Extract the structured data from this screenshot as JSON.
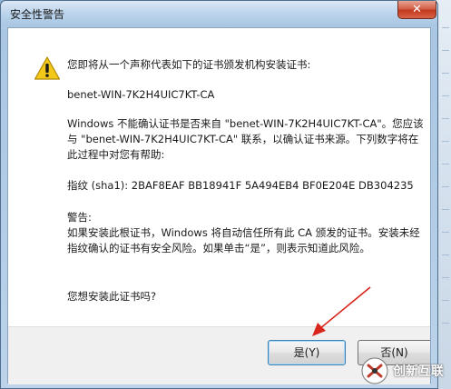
{
  "window": {
    "title": "安全性警告",
    "close_label": "✕"
  },
  "dialog": {
    "intro": "您即将从一个声称代表如下的证书颁发机构安装证书:",
    "ca_name": "benet-WIN-7K2H4UIC7KT-CA",
    "warning_text": "Windows 不能确认证书是否来自 \"benet-WIN-7K2H4UIC7KT-CA\"。您应该与 \"benet-WIN-7K2H4UIC7KT-CA\" 联系，以确认证书来源。下列数字将在此过程中对您有帮助:",
    "thumbprint": "指纹 (sha1): 2BAF8EAF BB18941F 5A494EB4 BF0E204E DB304235",
    "caution_title": "警告:",
    "caution_text": "如果安装此根证书，Windows 将自动信任所有此 CA 颁发的证书。安装未经指纹确认的证书有安全风险。如果单击“是”，则表示知道此风险。",
    "question": "您想安装此证书吗?"
  },
  "buttons": {
    "yes": "是(Y)",
    "no": "否(N)"
  },
  "watermark": {
    "text": "创新互联"
  },
  "colors": {
    "arrow": "#d9261c",
    "warning_icon": "#f4c81b",
    "close_button": "#c7432a"
  }
}
